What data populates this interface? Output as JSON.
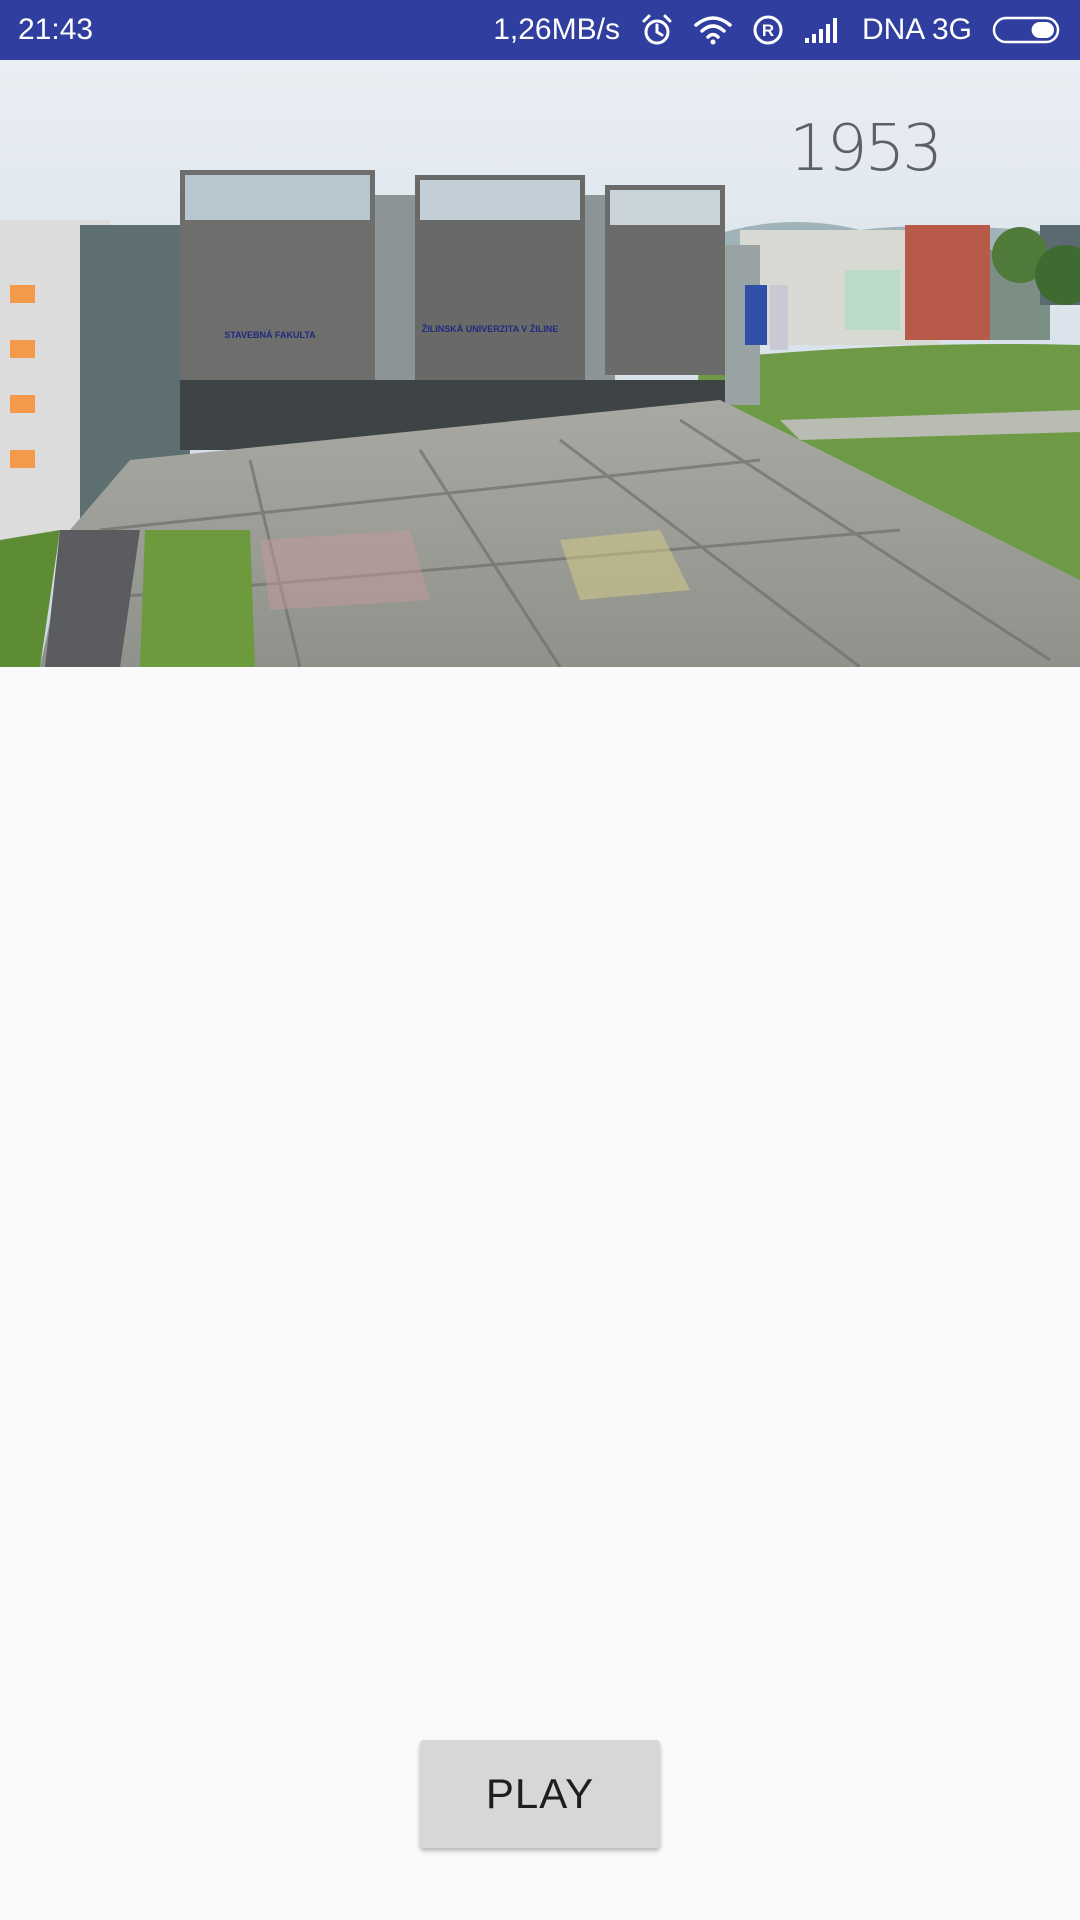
{
  "status_bar": {
    "time": "21:43",
    "network_speed": "1,26MB/s",
    "carrier": "DNA 3G",
    "icons": [
      "alarm-icon",
      "wifi-icon",
      "roaming-icon",
      "signal-icon",
      "battery-icon"
    ],
    "battery_level": 0.2,
    "background_color": "#303f9f"
  },
  "video": {
    "overlay_text": "1953",
    "building_signs": [
      "STAVEBNÁ FAKULTA",
      "ŽILINSKÁ UNIVERZITA V ŽILINE"
    ]
  },
  "controls": {
    "play_label": "PLAY"
  }
}
